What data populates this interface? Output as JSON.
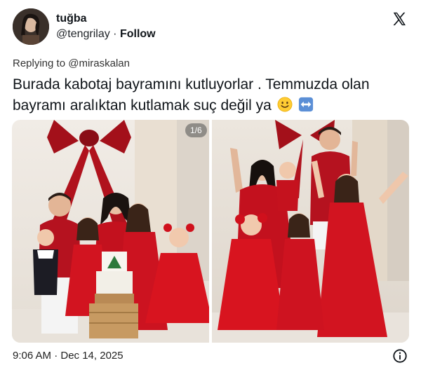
{
  "user": {
    "display_name": "tuğba",
    "handle": "@tengrilay",
    "separator": "·",
    "follow_label": "Follow"
  },
  "brand_icon": "x-logo-icon",
  "reply": {
    "prefix": "Replying to",
    "mention": "@miraskalan"
  },
  "tweet": {
    "text": "Burada kabotaj bayramını kutluyorlar . Temmuzda olan bayramı aralıktan kutlamak suç değil ya",
    "emojis": [
      "slightly-smiling-face",
      "left-right-arrow"
    ]
  },
  "media": {
    "counter": "1/6",
    "photos": [
      "family-red-outfits-christmas-cake",
      "family-red-outfits-celebrating"
    ]
  },
  "footer": {
    "timestamp": "9:06 AM · Dec 14, 2025",
    "info_icon": "info-icon"
  },
  "colors": {
    "text": "#0f1419",
    "accent_red": "#c8102e",
    "emoji_yellow": "#ffcc33",
    "arrow_blue": "#5b8fd6"
  }
}
